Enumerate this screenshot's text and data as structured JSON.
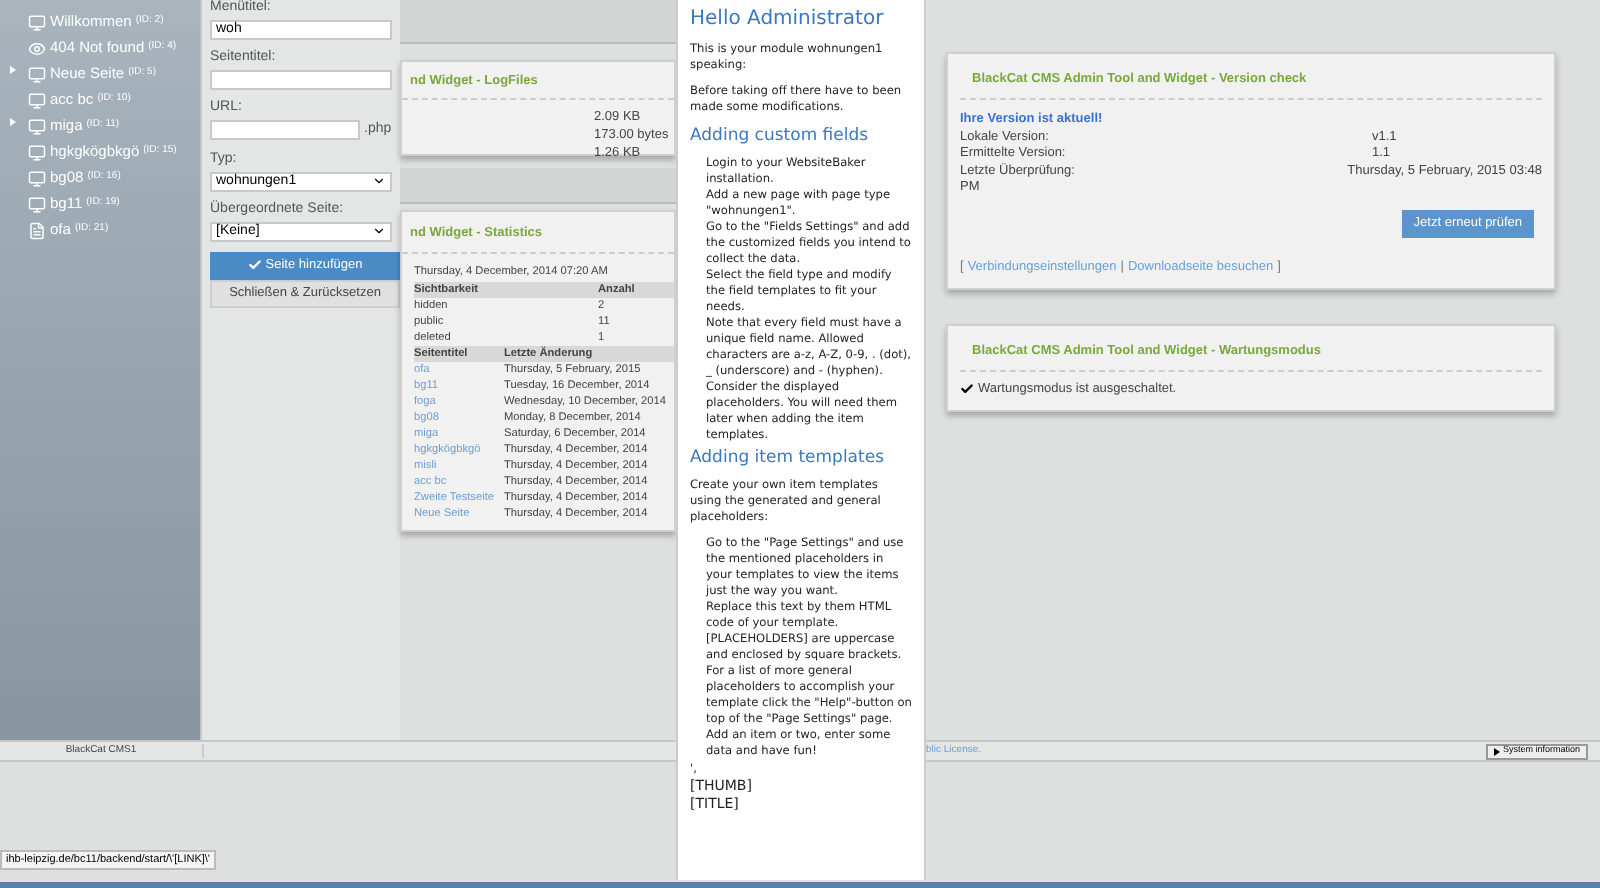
{
  "sidebar": {
    "items": [
      {
        "label": "Willkommen",
        "id": "(ID: 2)",
        "kind": "page",
        "expandable": false
      },
      {
        "label": "404 Not found",
        "id": "(ID: 4)",
        "kind": "hidden",
        "expandable": false
      },
      {
        "label": "Neue Seite",
        "id": "(ID: 5)",
        "kind": "page",
        "expandable": true
      },
      {
        "label": "acc bc",
        "id": "(ID: 10)",
        "kind": "page",
        "expandable": false
      },
      {
        "label": "miga",
        "id": "(ID: 11)",
        "kind": "page",
        "expandable": true
      },
      {
        "label": "hgkgkögbkgö",
        "id": "(ID: 15)",
        "kind": "page",
        "expandable": false
      },
      {
        "label": "bg08",
        "id": "(ID: 16)",
        "kind": "page",
        "expandable": false
      },
      {
        "label": "bg11",
        "id": "(ID: 19)",
        "kind": "page",
        "expandable": false
      },
      {
        "label": "ofa",
        "id": "(ID: 21)",
        "kind": "file",
        "expandable": false
      }
    ]
  },
  "form": {
    "fields": [
      {
        "kind": "text",
        "label": "Menütitel:",
        "value": "woh"
      },
      {
        "kind": "text",
        "label": "Seitentitel:"
      },
      {
        "kind": "url",
        "label": "URL:",
        "suffix": ".php"
      },
      {
        "kind": "select",
        "label": "Typ:",
        "value": "wohnungen1"
      },
      {
        "kind": "select",
        "label": "Übergeordnete Seite:",
        "value": "[Keine]"
      }
    ],
    "buttons": [
      {
        "label": "Seite hinzufügen",
        "kind": "primary"
      },
      {
        "label": "Schließen & Zurücksetzen",
        "kind": "secondary"
      }
    ]
  },
  "logfiles": {
    "title": "nd Widget - LogFiles",
    "values": [
      "2.09 KB",
      "173.00 bytes",
      "1.26 KB"
    ]
  },
  "statistics": {
    "title": "nd Widget - Statistics",
    "date": "Thursday, 4 December, 2014 07:20 AM",
    "visibility": {
      "columns": [
        "Sichtbarkeit",
        "Anzahl"
      ],
      "rows": [
        [
          "hidden",
          "2"
        ],
        [
          "public",
          "11"
        ],
        [
          "deleted",
          "1"
        ]
      ]
    },
    "pages": {
      "columns": [
        "Seitentitel",
        "Letzte Änderung"
      ],
      "rows": [
        [
          "ofa",
          "Thursday, 5 February, 2015"
        ],
        [
          "bg11",
          "Tuesday, 16 December, 2014"
        ],
        [
          "foga",
          "Wednesday, 10 December, 2014"
        ],
        [
          "bg08",
          "Monday, 8 December, 2014"
        ],
        [
          "miga",
          "Saturday, 6 December, 2014"
        ],
        [
          "hgkgkögbkgö",
          "Thursday, 4 December, 2014"
        ],
        [
          "misli",
          "Thursday, 4 December, 2014"
        ],
        [
          "acc bc",
          "Thursday, 4 December, 2014"
        ],
        [
          "Zweite Testseite",
          "Thursday, 4 December, 2014"
        ],
        [
          "Neue Seite",
          "Thursday, 4 December, 2014"
        ]
      ]
    }
  },
  "popup": {
    "blocks": [
      {
        "kind": "title",
        "text": "Hello Administrator"
      },
      {
        "kind": "para",
        "text": "This is your module wohnungen1 speaking:"
      },
      {
        "kind": "para",
        "text": "Before taking off there have to been made some modifications."
      },
      {
        "kind": "heading",
        "text": "Adding custom fields"
      },
      {
        "kind": "indent",
        "lines": [
          "Login to your WebsiteBaker installation.",
          "Add a new page with page type \"wohnungen1\".",
          "Go to the \"Fields Settings\" and add the customized fields you intend to collect the data.",
          "Select the field type and modify the field templates to fit your needs.",
          "Note that every field must have a unique field name. Allowed characters are a-z, A-Z, 0-9, . (dot), _ (underscore) and - (hyphen).",
          "Consider the displayed placeholders. You will need them later when adding the item templates."
        ]
      },
      {
        "kind": "heading",
        "text": "Adding item templates"
      },
      {
        "kind": "para",
        "text": "Create your own item templates using the generated and general placeholders:"
      },
      {
        "kind": "indent",
        "lines": [
          "Go to the \"Page Settings\" and use the mentioned placeholders in your templates to view the items just the way you want.",
          "Replace this text by them HTML code of your template.",
          "[PLACEHOLDERS] are uppercase and enclosed by square brackets.",
          "For a list of more general placeholders to accomplish your template click the \"Help\"-button on top of the \"Page Settings\" page.",
          "Add an item or two, enter some data and have fun!"
        ]
      },
      {
        "kind": "plain",
        "lines": [
          "',",
          "[THUMB]",
          "[TITLE]"
        ]
      }
    ]
  },
  "version_check": {
    "title": "BlackCat CMS Admin Tool and Widget - Version check",
    "status": "Ihre Version ist aktuell!",
    "rows": [
      {
        "label": "Lokale Version:",
        "value": "v1.1"
      },
      {
        "label": "Ermittelte Version:",
        "value": "1.1"
      },
      {
        "label": "Letzte Überprüfung:",
        "value": "Thursday, 5 February, 2015 03:48"
      }
    ],
    "label_continuation": "PM",
    "button": "Jetzt erneut prüfen",
    "links": [
      "Verbindungseinstellungen",
      "Downloadseite besuchen"
    ],
    "bracket_open": "[",
    "separator": "|",
    "bracket_close": "]"
  },
  "maintenance": {
    "title": "BlackCat CMS Admin Tool and Widget - Wartungsmodus",
    "status": "Wartungsmodus ist ausgeschaltet."
  },
  "footer": {
    "left": "BlackCat CMS1",
    "link": "blic License.",
    "button": "System information"
  },
  "status_url": "ihb-leipzig.de/bc11/backend/start/\\'[LINK]\\'"
}
